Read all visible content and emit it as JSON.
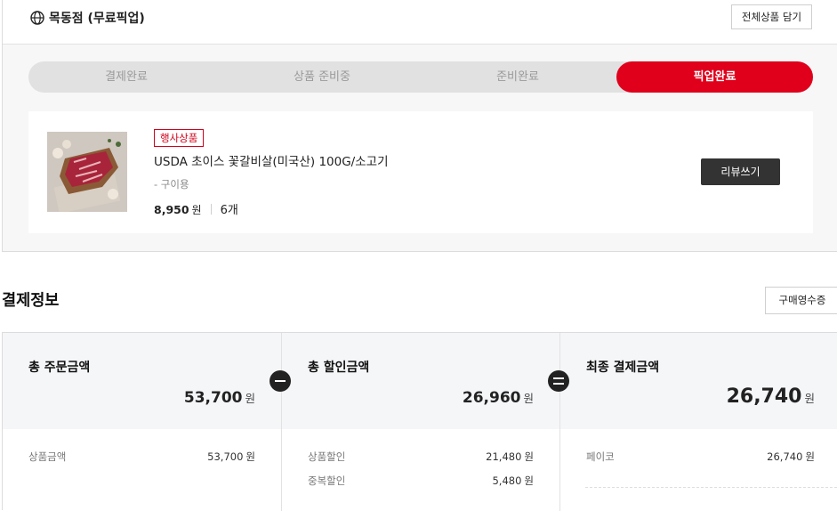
{
  "store": {
    "name": "목동점 (무료픽업)",
    "add_all_label": "전체상품 담기"
  },
  "progress": {
    "steps": [
      "결제완료",
      "상품 준비중",
      "준비완료",
      "픽업완료"
    ],
    "active_index": 3,
    "active_color": "#e0001b"
  },
  "product": {
    "badge": "행사상품",
    "name": "USDA 초이스 꽃갈비살(미국산) 100G/소고기",
    "option": "- 구이용",
    "price": "8,950",
    "price_unit": "원",
    "quantity": "6개",
    "review_label": "리뷰쓰기"
  },
  "payment": {
    "title": "결제정보",
    "receipt_label": "구매영수증",
    "unit": "원",
    "total_order": {
      "label": "총 주문금액",
      "amount": "53,700",
      "details": [
        {
          "label": "상품금액",
          "value": "53,700"
        }
      ]
    },
    "total_discount": {
      "label": "총 할인금액",
      "amount": "26,960",
      "details": [
        {
          "label": "상품할인",
          "value": "21,480"
        },
        {
          "label": "중복할인",
          "value": "5,480"
        }
      ]
    },
    "final": {
      "label": "최종 결제금액",
      "amount": "26,740",
      "details": [
        {
          "label": "페이코",
          "value": "26,740"
        }
      ]
    }
  },
  "icons": {
    "store": "globe-icon",
    "minus": "minus-circle-icon",
    "equals": "equals-circle-icon"
  }
}
